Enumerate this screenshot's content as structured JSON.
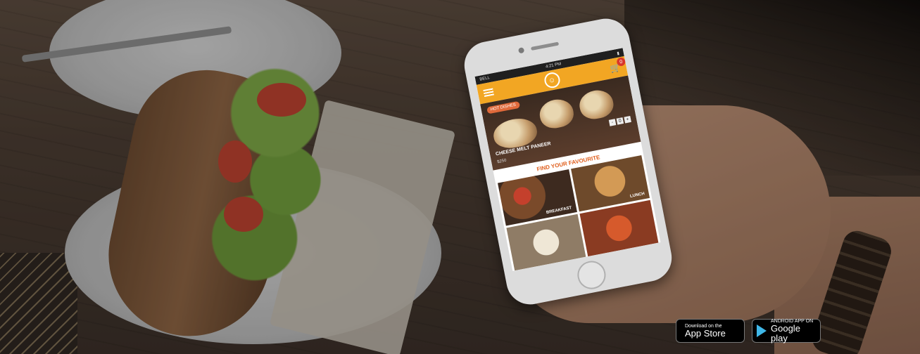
{
  "phone": {
    "status": {
      "carrier": "BELL",
      "time": "4:21 PM"
    },
    "cart_count": "0",
    "hero": {
      "tag": "HOT DISHES",
      "dish_name": "CHEESE MELT PANEER",
      "price": "$250",
      "qty_minus": "-",
      "qty_plus": "+",
      "qty_value": "0"
    },
    "section_title": "FIND YOUR FAVOURITE",
    "tiles": [
      {
        "label": "BREAKFAST"
      },
      {
        "label": "LUNCH"
      },
      {
        "label": ""
      },
      {
        "label": ""
      }
    ]
  },
  "badges": {
    "appstore": {
      "small": "Download on the",
      "big": "App Store",
      "icon": "apple-icon"
    },
    "googleplay": {
      "small": "ANDROID APP ON",
      "big": "Google play",
      "icon": "play-icon"
    }
  }
}
